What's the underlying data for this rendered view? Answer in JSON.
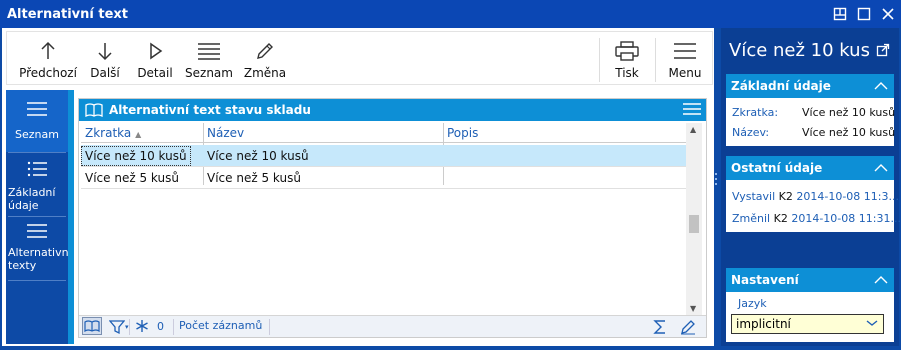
{
  "window": {
    "title": "Alternativní text"
  },
  "toolbar": {
    "prev": "Předchozí",
    "next": "Další",
    "detail": "Detail",
    "list": "Seznam",
    "edit": "Změna",
    "print": "Tisk",
    "menu": "Menu"
  },
  "sidenav": {
    "items": [
      {
        "label": "Seznam"
      },
      {
        "label": "Základní údaje"
      },
      {
        "label": "Alternativní texty"
      }
    ]
  },
  "grid": {
    "title": "Alternativní text stavu skladu",
    "columns": [
      "Zkratka",
      "Název",
      "Popis"
    ],
    "rows": [
      {
        "zkratka": "Více než 10 kusů",
        "nazev": "Více než 10 kusů",
        "popis": ""
      },
      {
        "zkratka": "Více než 5 kusů",
        "nazev": "Více než 5 kusů",
        "popis": ""
      }
    ],
    "footer": {
      "filter_count": "0",
      "record_count_label": "Počet záznamů"
    }
  },
  "detail": {
    "title": "Více než 10 kus...",
    "basic": {
      "header": "Základní údaje",
      "zkratka_label": "Zkratka:",
      "zkratka_value": "Více než 10 kusů",
      "nazev_label": "Název:",
      "nazev_value": "Více než 10 kusů"
    },
    "other": {
      "header": "Ostatní údaje",
      "created_label": "Vystavil",
      "created_user": "K2",
      "created_date": "2014-10-08 11:3...",
      "changed_label": "Změnil",
      "changed_user": "K2",
      "changed_date": "2014-10-08 11:31..."
    },
    "settings": {
      "header": "Nastavení",
      "language_label": "Jazyk",
      "language_value": "implicitní"
    }
  },
  "colors": {
    "accent": "#0d8fd6",
    "frame": "#0b47b4",
    "selected_row": "#c6e8fb"
  }
}
